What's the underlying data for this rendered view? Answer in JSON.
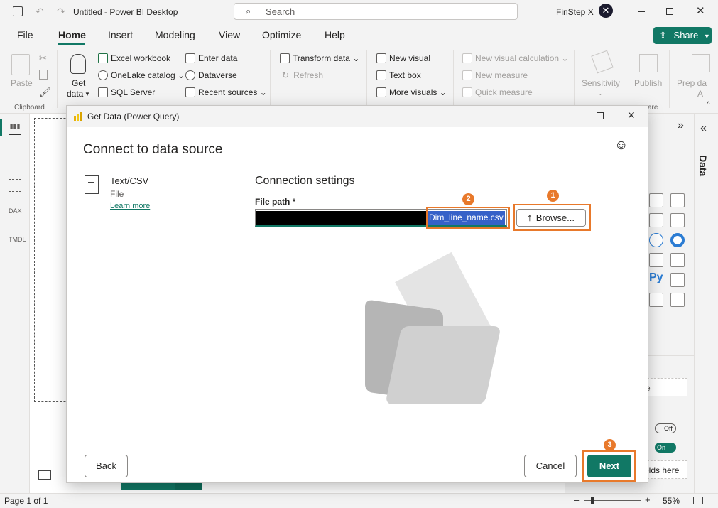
{
  "titlebar": {
    "title": "Untitled - Power BI Desktop",
    "search": "Search",
    "user": "FinStep X"
  },
  "menu": {
    "file": "File",
    "home": "Home",
    "insert": "Insert",
    "modeling": "Modeling",
    "view": "View",
    "optimize": "Optimize",
    "help": "Help",
    "share": "Share"
  },
  "ribbon": {
    "paste": "Paste",
    "clipboard": "Clipboard",
    "get_data_1": "Get",
    "get_data_2": "data",
    "excel": "Excel workbook",
    "onelake": "OneLake catalog",
    "sql": "SQL Server",
    "enter_data": "Enter data",
    "dataverse": "Dataverse",
    "recent": "Recent sources",
    "transform": "Transform data",
    "refresh": "Refresh",
    "new_visual": "New visual",
    "text_box": "Text box",
    "more_visuals": "More visuals",
    "new_calc": "New visual calculation",
    "new_measure": "New measure",
    "quick_measure": "Quick measure",
    "sensitivity": "Sensitivity",
    "publish": "Publish",
    "prep": "Prep da",
    "prep2": "A",
    "share_frag": "are"
  },
  "rightpane": {
    "data_label": "Data",
    "off": "Off",
    "on": "On",
    "fields_frag": "elds here",
    "field_frag": "e"
  },
  "status": {
    "page": "Page 1 of 1",
    "zoom": "55%"
  },
  "dialog": {
    "title": "Get Data (Power Query)",
    "heading": "Connect to data source",
    "source_name": "Text/CSV",
    "source_type": "File",
    "learn_more": "Learn more",
    "settings_heading": "Connection settings",
    "file_path_label": "File path *",
    "file_name": "Dim_line_name.csv",
    "browse": "Browse...",
    "back": "Back",
    "cancel": "Cancel",
    "next": "Next",
    "badge1": "1",
    "badge2": "2",
    "badge3": "3"
  }
}
